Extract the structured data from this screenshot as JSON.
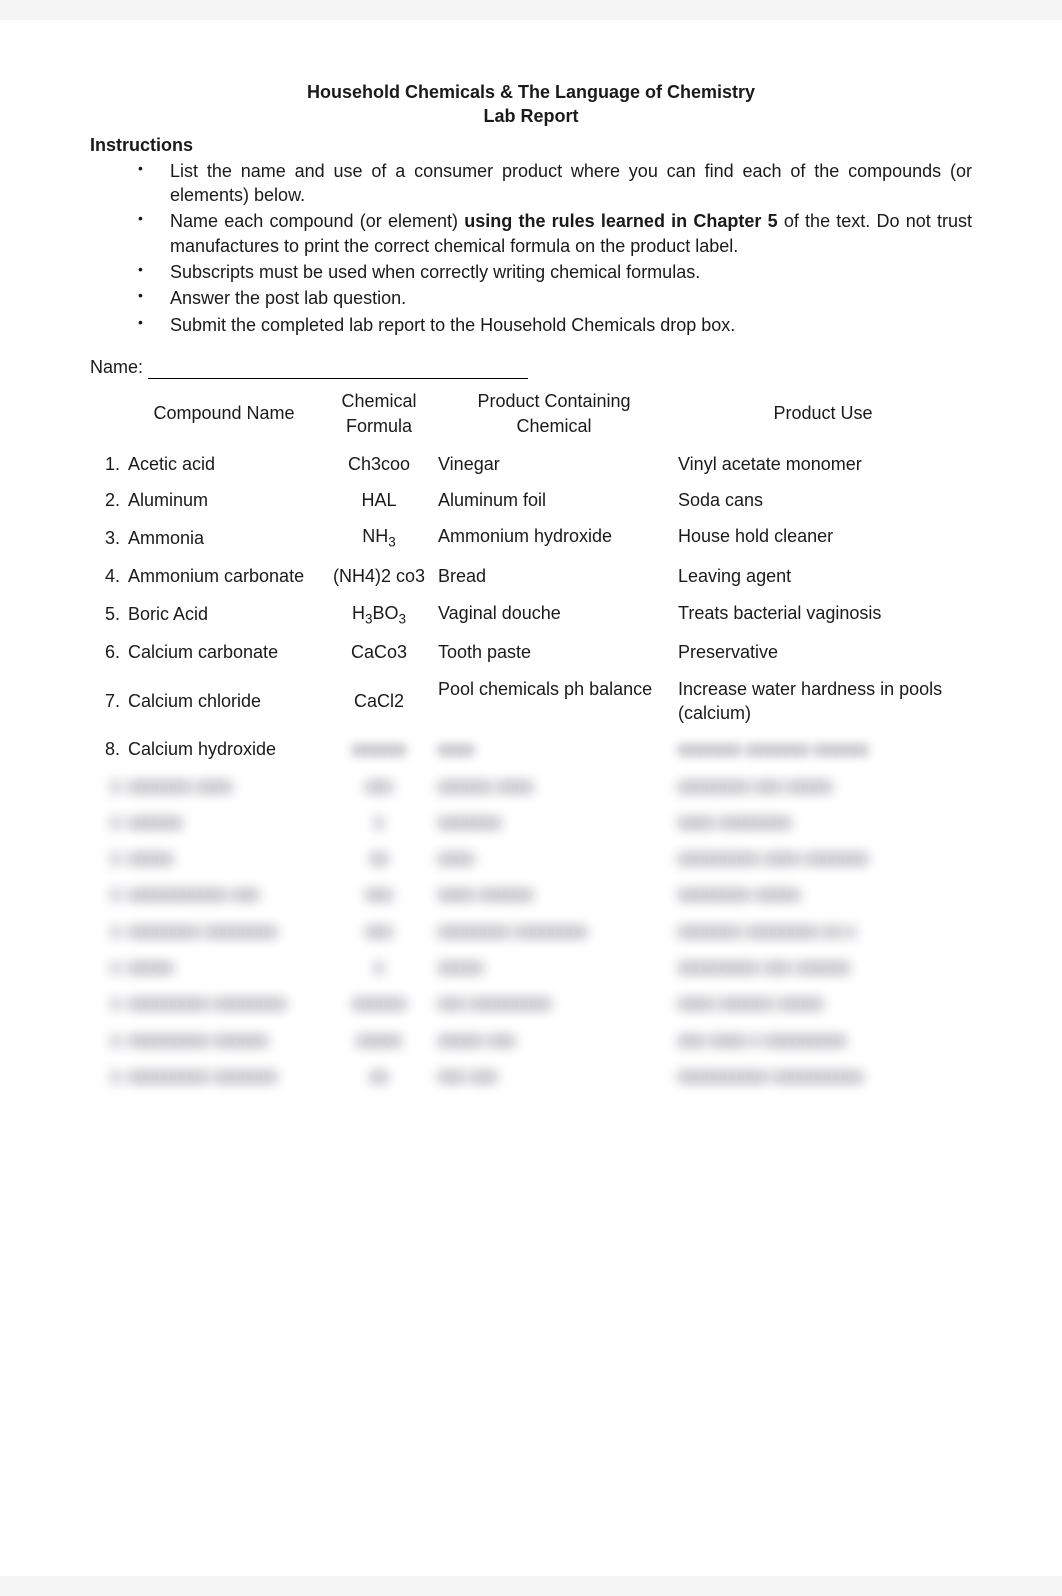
{
  "title": "Household Chemicals & The Language of Chemistry",
  "subtitle": "Lab Report",
  "instructions_heading": "Instructions",
  "instructions": [
    "List the name and use of a consumer product where you can find each of the compounds (or elements) below.",
    "Name each compound (or element) using the rules learned in Chapter 5 of the text.  Do not trust manufactures to print the correct chemical formula on the product label.",
    "Subscripts must be used when correctly writing chemical formulas.",
    "Answer the post lab question.",
    "Submit the completed lab report to the Household Chemicals drop box."
  ],
  "instruction_bold_index": 1,
  "instruction_bold_phrase": "using the rules learned in Chapter 5",
  "name_label": "Name:",
  "headers": {
    "compound": "Compound Name",
    "formula": "Chemical Formula",
    "product": "Product Containing Chemical",
    "use": "Product Use"
  },
  "rows": [
    {
      "num": "1.",
      "name": "Acetic acid",
      "formula": "Ch3coo",
      "product": "Vinegar",
      "use": "Vinyl acetate monomer"
    },
    {
      "num": "2.",
      "name": "Aluminum",
      "formula": "HAL",
      "product": "Aluminum foil",
      "use": "Soda cans"
    },
    {
      "num": "3.",
      "name": "Ammonia",
      "formula_html": "NH<span class=\"sub\">3</span>",
      "product": "Ammonium hydroxide",
      "use": "House hold cleaner"
    },
    {
      "num": "4.",
      "name": "Ammonium carbonate",
      "formula": "(NH4)2 co3",
      "product": "Bread",
      "use": "Leaving agent"
    },
    {
      "num": "5.",
      "name": "Boric Acid",
      "formula_html": "H<span class=\"sub\">3</span>BO<span class=\"sub\">3</span>",
      "product": "Vaginal douche",
      "use": "Treats bacterial vaginosis"
    },
    {
      "num": "6.",
      "name": "Calcium carbonate",
      "formula": "CaCo3",
      "product": "Tooth paste",
      "use": "Preservative"
    },
    {
      "num": "7.",
      "name": "Calcium chloride",
      "formula": "CaCl2",
      "product": "Pool chemicals ph balance",
      "use": "Increase water hardness in pools (calcium)"
    },
    {
      "num": "8.",
      "name": "Calcium hydroxide",
      "formula_blur": "xxxxxx",
      "product_blur": "xxxx",
      "use_blur": "xxxxxxx xxxxxxx xxxxxx"
    }
  ],
  "blurred_rows": [
    {
      "num": "",
      "name": "xxxxxxx xxxx",
      "formula": "xxx",
      "product": "xxxxxx xxxx",
      "use": "xxxxxxxx xxx xxxxx"
    },
    {
      "num": "",
      "name": "xxxxxx",
      "formula": "x",
      "product": "xxxxxxx",
      "use": "xxxx xxxxxxxx"
    },
    {
      "num": "",
      "name": "xxxxx",
      "formula": "xx",
      "product": "xxxx",
      "use": "xxxxxxxxx xxxx xxxxxxx"
    },
    {
      "num": "",
      "name": "xxxxxxxxxxx xxx",
      "formula": "xxx",
      "product": "xxxx xxxxxx",
      "use": "xxxxxxxx xxxxx"
    },
    {
      "num": "",
      "name": "xxxxxxxx xxxxxxxx",
      "formula": "xxx",
      "product": "xxxxxxxx xxxxxxxx",
      "use": "xxxxxxx xxxxxxxx xx x"
    },
    {
      "num": "",
      "name": "xxxxx",
      "formula": "x",
      "product": "xxxxx",
      "use": "xxxxxxxxx xxx xxxxxx"
    },
    {
      "num": "",
      "name": "xxxxxxxxx xxxxxxxx",
      "formula": "xxxxxx",
      "product": "xxx xxxxxxxxx",
      "use": "xxxx xxxxxx xxxxx"
    },
    {
      "num": "",
      "name": "xxxxxxxxx xxxxxx",
      "formula": "xxxxx",
      "product": "xxxxx xxx",
      "use": "xxx xxxx x xxxxxxxxx"
    },
    {
      "num": "",
      "name": "xxxxxxxxx xxxxxxx",
      "formula": "xx",
      "product": "xxx xxx",
      "use": "xxxxxxxxxx xxxxxxxxxx"
    }
  ]
}
